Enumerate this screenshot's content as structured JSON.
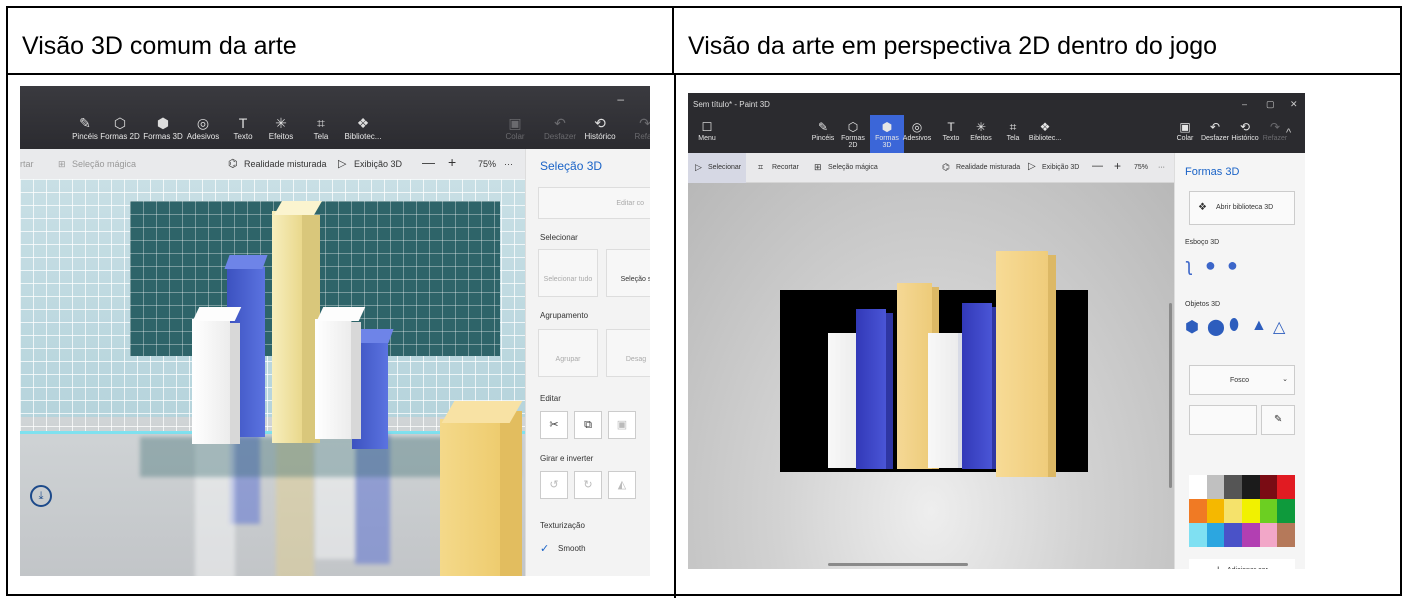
{
  "table": {
    "left_header": "Visão 3D comum da arte",
    "right_header": "Visão da arte em perspectiva 2D dentro do jogo"
  },
  "left_screenshot": {
    "toolbar": [
      {
        "label": "Pincéis",
        "icon": "brush-icon",
        "glyph": "✎"
      },
      {
        "label": "Formas 2D",
        "icon": "shapes-2d-icon",
        "glyph": "⬡"
      },
      {
        "label": "Formas 3D",
        "icon": "shapes-3d-icon",
        "glyph": "⬢"
      },
      {
        "label": "Adesivos",
        "icon": "stickers-icon",
        "glyph": "◎"
      },
      {
        "label": "Texto",
        "icon": "text-icon",
        "glyph": "T"
      },
      {
        "label": "Efeitos",
        "icon": "effects-icon",
        "glyph": "✳"
      },
      {
        "label": "Tela",
        "icon": "canvas-icon",
        "glyph": "⌗"
      },
      {
        "label": "Bibliotec...",
        "icon": "library-icon",
        "glyph": "❖"
      }
    ],
    "right_tools": [
      {
        "label": "Colar",
        "icon": "paste-icon",
        "glyph": "▣"
      },
      {
        "label": "Desfazer",
        "icon": "undo-icon",
        "glyph": "↶"
      },
      {
        "label": "Histórico",
        "icon": "history-icon",
        "glyph": "⟲"
      },
      {
        "label": "Refaz",
        "icon": "redo-icon",
        "glyph": "↷"
      }
    ],
    "subbar": {
      "crop_partial": "rtar",
      "magic_select": "Seleção mágica",
      "mixed_reality": "Realidade misturada",
      "view_3d": "Exibição 3D",
      "zoom": "75%",
      "more": "···"
    },
    "sidebar": {
      "title": "Seleção 3D",
      "edit_color": "Editar co",
      "select_heading": "Selecionar",
      "select_all": "Selecionar tudo",
      "select_partial": "Seleção s",
      "group_heading": "Agrupamento",
      "group": "Agrupar",
      "ungroup": "Desag",
      "edit_heading": "Editar",
      "rotate_heading": "Girar e inverter",
      "texture_heading": "Texturização",
      "smooth": "Smooth"
    },
    "colors": {
      "white_bar": "#f4f4f4",
      "blue_bar": "#4a63d4",
      "yellow_bar": "#f2e6a8",
      "board": "#2e6469"
    }
  },
  "right_screenshot": {
    "title": "Sem título* - Paint 3D",
    "window_buttons": [
      "–",
      "▢",
      "✕"
    ],
    "menu": {
      "label": "Menu",
      "icon": "menu-icon",
      "glyph": "☐"
    },
    "toolbar": [
      {
        "label": "Pincéis",
        "icon": "brush-icon",
        "glyph": "✎"
      },
      {
        "label": "Formas 2D",
        "icon": "shapes-2d-icon",
        "glyph": "⬡"
      },
      {
        "label": "Formas 3D",
        "icon": "shapes-3d-icon",
        "glyph": "⬢"
      },
      {
        "label": "Adesivos",
        "icon": "stickers-icon",
        "glyph": "◎"
      },
      {
        "label": "Texto",
        "icon": "text-icon",
        "glyph": "T"
      },
      {
        "label": "Efeitos",
        "icon": "effects-icon",
        "glyph": "✳"
      },
      {
        "label": "Tela",
        "icon": "canvas-icon",
        "glyph": "⌗"
      },
      {
        "label": "Bibliotec...",
        "icon": "library-icon",
        "glyph": "❖"
      }
    ],
    "right_tools": [
      {
        "label": "Colar",
        "icon": "paste-icon",
        "glyph": "▣"
      },
      {
        "label": "Desfazer",
        "icon": "undo-icon",
        "glyph": "↶"
      },
      {
        "label": "Histórico",
        "icon": "history-icon",
        "glyph": "⟲"
      },
      {
        "label": "Refazer",
        "icon": "redo-icon",
        "glyph": "↷"
      }
    ],
    "subbar": {
      "select": "Selecionar",
      "crop": "Recortar",
      "magic_select": "Seleção mágica",
      "mixed_reality": "Realidade misturada",
      "view_3d": "Exibição 3D",
      "zoom": "75%",
      "more": "···"
    },
    "sidebar": {
      "title": "Formas 3D",
      "open_library": "Abrir biblioteca 3D",
      "sketch_heading": "Esboço 3D",
      "objects_heading": "Objetos 3D",
      "material": "Fosco",
      "add_color": "Adicionar cor",
      "palette": [
        "#ffffff",
        "#c0c0c0",
        "#555555",
        "#1b1b1b",
        "#7a0c14",
        "#e11b22",
        "#f07a24",
        "#f5b800",
        "#f5e26b",
        "#f1f100",
        "#6ccf22",
        "#0e9a3c",
        "#7fe0f2",
        "#2ca6e0",
        "#4a52c8",
        "#b23fb2",
        "#f2a7c8",
        "#b5795a"
      ]
    },
    "colors": {
      "white_bar": "#f6f6f6",
      "blue_bar": "#3e47c9",
      "yellow_bar": "#f2d28c",
      "board": "#000000",
      "active_tab": "#3b66d8"
    }
  }
}
